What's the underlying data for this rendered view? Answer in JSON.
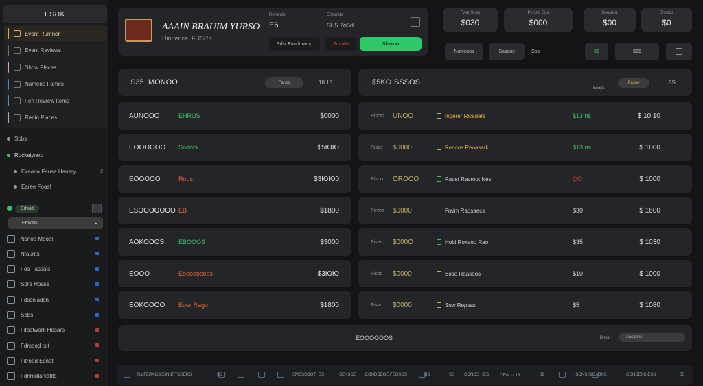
{
  "sidebar": {
    "logo": "ESƏK",
    "group_items": [
      {
        "label": "Event Rumner",
        "color": "#d8b04a",
        "active": true
      },
      {
        "label": "Event Reviews",
        "color": "#6a6a6a",
        "active": false
      },
      {
        "label": "Show Places",
        "color": "#d4a0c8",
        "active": false
      },
      {
        "label": "Nameno Fames",
        "color": "#5a78d8",
        "active": false
      },
      {
        "label": "Fen Revrew Items",
        "color": "#5a88c8",
        "active": false
      },
      {
        "label": "Renin Places",
        "color": "#c0a0d0",
        "active": false
      }
    ],
    "plain_item": "Sbbs",
    "section_title": "Rocketward",
    "sub_items": [
      {
        "label": "Exaana Fause Hanery",
        "tail": "2"
      },
      {
        "label": "Earee Foasl",
        "tail": ""
      }
    ],
    "green_pill": "Edwid",
    "selected_item": "Edwins",
    "icon_items": [
      {
        "label": "Nsnoe Mooel",
        "mark": "#2e64c8"
      },
      {
        "label": "Nfaurits",
        "mark": "#2e64c8"
      },
      {
        "label": "Fos Fassals",
        "mark": "#2e64c8"
      },
      {
        "label": "Sbre Hoass",
        "mark": "#2e64c8"
      },
      {
        "label": "Fdssniadsn",
        "mark": "#2e64c8"
      },
      {
        "label": "Sbbs",
        "mark": "#2e64c8"
      },
      {
        "label": "Fitastwork Hesars",
        "mark": "#b84030"
      },
      {
        "label": "Fdrsood tsit",
        "mark": "#b84030"
      },
      {
        "label": "Fitrood Esnot",
        "mark": "#b84030"
      },
      {
        "label": "Fdnrodlaniatlts",
        "mark": "#b84030"
      }
    ]
  },
  "header": {
    "title": "AAAIN BRAUIM YURSO",
    "subtitle": "Uinnence. FUSRK.",
    "col1_label": "Ronsnds",
    "col1_value": "E6",
    "col2_label": "Ehnsnds",
    "col2_value": "5H5 2o5d",
    "buttons": {
      "dark": "Sdsr Eaodmamp",
      "red": "Snooler",
      "green": "Sheroo"
    }
  },
  "stats": [
    {
      "label": "Fwer Snoo",
      "value": "$030"
    },
    {
      "label": "Pvrsnd Sos",
      "value": "$000"
    },
    {
      "label": "Sonsnos",
      "value": "$00"
    },
    {
      "label": "Sivmos",
      "value": "$0"
    }
  ],
  "toolbar": {
    "btn1": "Nawenos",
    "btn2": "Sasaus",
    "btn3": "Sos",
    "btn4": "$$",
    "btn5": "$$$"
  },
  "left_panel": {
    "header_left": "S35",
    "header_title": "MONOO",
    "header_pill": "Fanos",
    "header_right": "18   18",
    "rows": [
      {
        "name": "AUNOOO",
        "tag": "EHRUS",
        "tag_color": "#3fc060",
        "amount": "$0000"
      },
      {
        "name": "EOOOOOO",
        "tag": "Sodots",
        "tag_color": "#3fc060",
        "amount": "$5ЮЮ"
      },
      {
        "name": "EOOOOO",
        "tag": "Rous",
        "tag_color": "#d86a30",
        "amount": "$3ЮЮ0"
      },
      {
        "name": "ESOOOOOOO",
        "tag": "EB",
        "tag_color": "#d86a30",
        "amount": "$1800"
      },
      {
        "name": "AOKOOOS",
        "tag": "EBOOOS",
        "tag_color": "#3fc060",
        "amount": "$3000"
      },
      {
        "name": "EOOO",
        "tag": "Eooooosoos",
        "tag_color": "#d86a30",
        "amount": "$3ЮЮ"
      },
      {
        "name": "EOKOOOO",
        "tag": "Eoer Rago",
        "tag_color": "#d86a30",
        "amount": "$1800"
      }
    ],
    "footer": "EOOOOOOS"
  },
  "right_panel": {
    "header_left": "$5KO",
    "header_title": "SSSOS",
    "header_sub": "Esops",
    "header_pill": "Pasoo",
    "header_right": "8S",
    "rows": [
      {
        "label": "Risotri",
        "code": "UNOO",
        "code_color": "#c0b060",
        "icon_color": "#c0b060",
        "title": "Ingerer Ricaders",
        "title_color": "#e0b040",
        "pct": "$13 ns",
        "pct_color": "#3fc060",
        "amount": "$ 10.10"
      },
      {
        "label": "Risos",
        "code": "$0000",
        "code_color": "#c0b060",
        "icon_color": "#c0b060",
        "title": "Recoos Reoasark",
        "title_color": "#e0b040",
        "pct": "$13 ns",
        "pct_color": "#3fc060",
        "amount": "$ 1000"
      },
      {
        "label": "Risoo",
        "code": "OROOO",
        "code_color": "#c0b060",
        "icon_color": "#3fc060",
        "title": "Raost Ravroot Nes",
        "title_color": "#d0d0d0",
        "pct": "OO",
        "pct_color": "#d83a3a",
        "amount": "$ 1000"
      },
      {
        "label": "Pevoa",
        "code": "$0000",
        "code_color": "#c0b060",
        "icon_color": "#3fc060",
        "title": "Fraim Raosaacs",
        "title_color": "#d0d0d0",
        "pct": "$30",
        "pct_color": "#cfcfcf",
        "amount": "$ 1600"
      },
      {
        "label": "Piseo",
        "code": "$000O",
        "code_color": "#c0b060",
        "icon_color": "#3fc060",
        "title": "Hobi Roxeod Rao",
        "title_color": "#d0d0d0",
        "pct": "$35",
        "pct_color": "#cfcfcf",
        "amount": "$ 1030"
      },
      {
        "label": "Fisoo",
        "code": "$0000",
        "code_color": "#c0b060",
        "icon_color": "#c0b060",
        "title": "Boso Raasoos",
        "title_color": "#d0d0d0",
        "pct": "$10",
        "pct_color": "#cfcfcf",
        "amount": "$ 1000"
      },
      {
        "label": "Fisoo",
        "code": "$0000",
        "code_color": "#c0b060",
        "icon_color": "#c0b060",
        "title": "Sow Repsas",
        "title_color": "#d0d0d0",
        "pct": "$5",
        "pct_color": "#cfcfcf",
        "amount": "$ 1080"
      }
    ],
    "footer_label": "Bhns",
    "footer_pill": "Aasbons"
  },
  "footer": {
    "items": [
      "Ra FERAGSSSNSRTOSERS",
      "SS",
      "SMSSSOOT",
      "SS",
      "SENSOE",
      "EONDCEOE FEOSOS",
      "HS",
      "SS",
      "CONOS HES",
      "CEW ☆ 18",
      "08",
      "HSONS SIOASNS",
      "CONSENS ESS",
      "05"
    ]
  }
}
